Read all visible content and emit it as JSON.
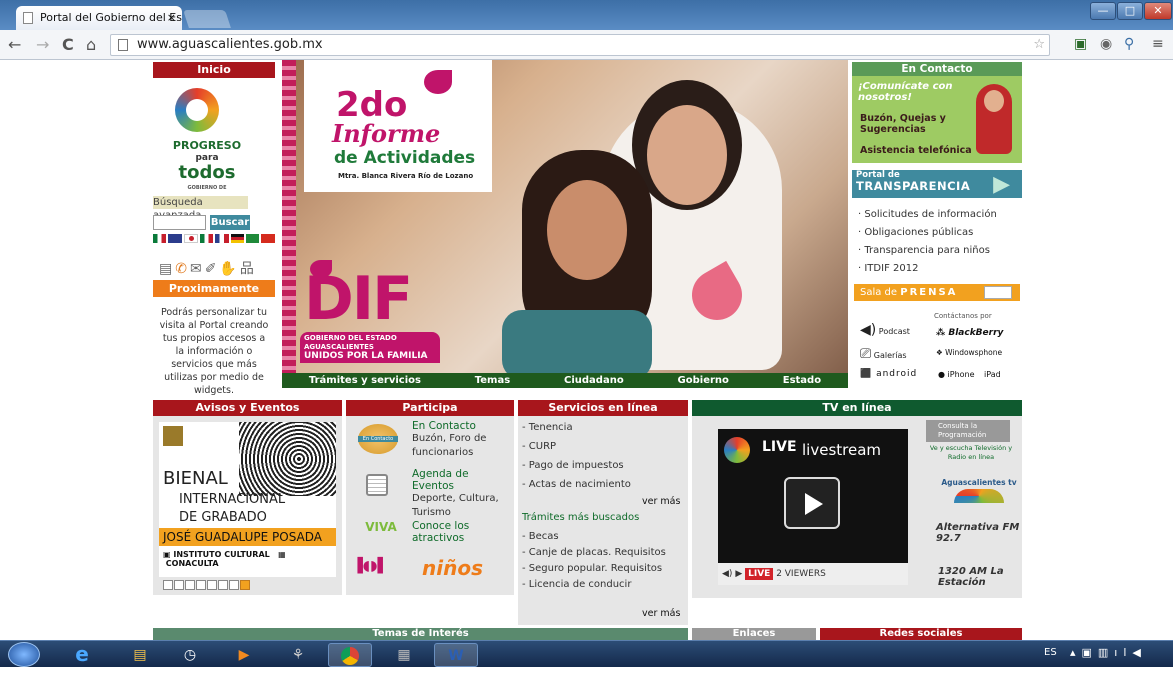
{
  "browser": {
    "tab_title": "Portal del Gobierno del Es",
    "tab_close": "×",
    "url": "www.aguascalientes.gob.mx",
    "back": "←",
    "forward": "→",
    "reload": "C",
    "home": "⌂"
  },
  "sidebar": {
    "inicio": "Inicio",
    "logo_line1": "PROGRESO",
    "logo_line2": "para",
    "logo_line3": "todos",
    "logo_sub": "GOBIERNO DE AGUASCALIENTES",
    "busqueda": "Búsqueda avanzada",
    "buscar": "Buscar",
    "proximamente": "Proximamente",
    "proximamente_text": "Podrás personalizar tu visita al Portal creando tus propios accesos a la información o servicios que más utilizas por medio de widgets."
  },
  "hero": {
    "informe_num": "2do",
    "informe_word": "Informe",
    "informe_sub": "de Actividades",
    "informe_name": "Mtra. Blanca Rivera Río de Lozano",
    "dif": "DIF",
    "dif_line1": "GOBIERNO DEL ESTADO",
    "dif_line2": "AGUASCALIENTES",
    "dif_line3": "UNIDOS POR LA FAMILIA",
    "nav": [
      "Trámites y servicios",
      "Temas",
      "Ciudadano",
      "Gobierno",
      "Estado"
    ]
  },
  "right": {
    "en_contacto": "En Contacto",
    "comunicate": "¡Comunícate con nosotros!",
    "buzon": "Buzón, Quejas y Sugerencias",
    "asistencia": "Asistencia telefónica",
    "portal_de": "Portal de",
    "transparencia": "TRANSPARENCIA",
    "links": [
      "Solicitudes de información",
      "Obligaciones públicas",
      "Transparencia para niños",
      "ITDIF 2012"
    ],
    "sala": "Sala de",
    "prensa": "PRENSA",
    "contactanos": "Contáctanos por",
    "podcast": "Podcast",
    "galerias": "Galerías",
    "blackberry": "BlackBerry",
    "windowsphone": "Windowsphone",
    "android": "android",
    "iphone": "iPhone",
    "ipad": "iPad"
  },
  "sections": {
    "avisos": "Avisos y Eventos",
    "participa": "Participa",
    "servicios": "Servicios en línea",
    "tv": "TV en línea",
    "bienal": [
      "BIENAL",
      "INTERNACIONAL",
      "DE GRABADO",
      "JOSÉ GUADALUPE POSADA"
    ],
    "conaculta": "CONACULTA",
    "participa_items": [
      {
        "title": "En Contacto",
        "text": "Buzón, Foro de funcionarios"
      },
      {
        "title": "Agenda de Eventos",
        "text": "Deporte, Cultura, Turismo"
      },
      {
        "title": "Conoce los",
        "text": "atractivos"
      }
    ],
    "ninos": "niños",
    "servicios_list": [
      "Tenencia",
      "CURP",
      "Pago de impuestos",
      "Actas de nacimiento"
    ],
    "ver_mas": "ver más",
    "tramites_title": "Trámites más buscados",
    "tramites_list": [
      "Becas",
      "Canje de placas. Requisitos",
      "Seguro popular. Requisitos",
      "Licencia de conducir"
    ],
    "tv_live": "LIVE",
    "tv_livestream": "livestream",
    "tv_viewers": "2 VIEWERS",
    "consulta": "Consulta la Programación",
    "ve_escucha": "Ve y escucha Televisión y Radio en línea",
    "aguas_tv": "Aguascalientes tv",
    "alternativa": "Alternativa FM 92.7",
    "estacion": "1320 AM La Estación",
    "temas_interes": "Temas de Interés",
    "enlaces": "Enlaces",
    "redes": "Redes sociales"
  },
  "taskbar": {
    "lang": "ES"
  }
}
